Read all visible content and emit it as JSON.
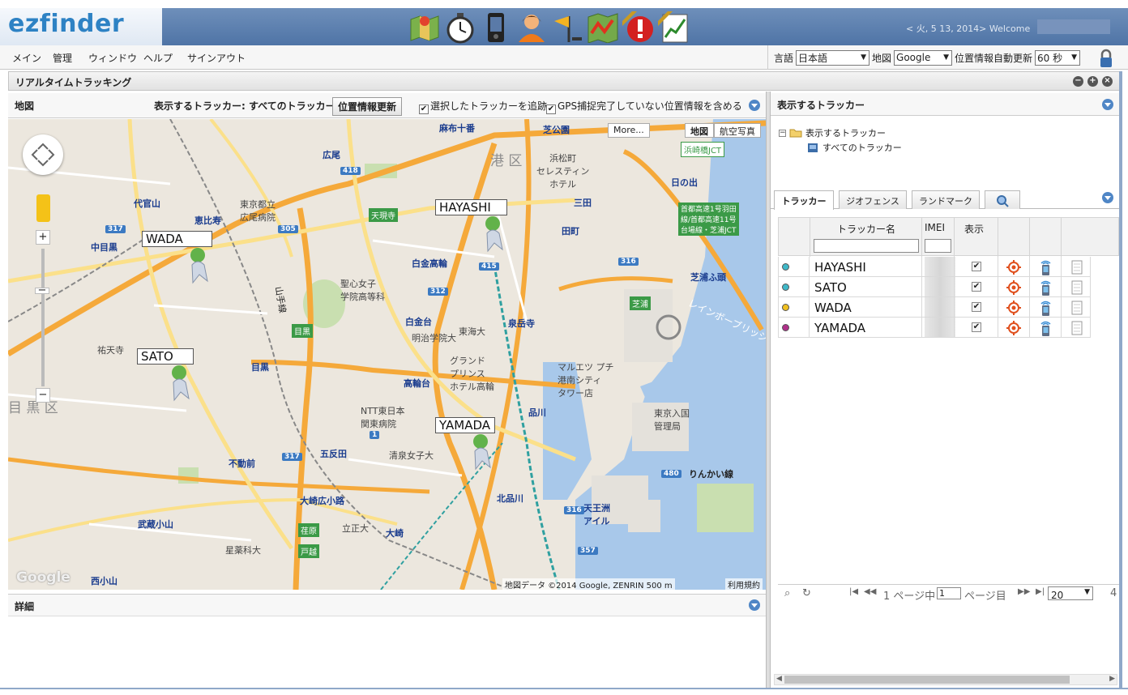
{
  "app": {
    "logo": "ezfinder",
    "welcome": "< 火, 5 13, 2014> Welcome"
  },
  "toolbar_icons": [
    "map-icon",
    "stopwatch-icon",
    "phone-icon",
    "user-icon",
    "flag-icon",
    "route-map-icon",
    "premium-alert-icon",
    "premium-report-icon"
  ],
  "menu": [
    "メイン",
    "管理",
    "ウィンドウ",
    "ヘルプ",
    "サインアウト"
  ],
  "settings": {
    "language_label": "言語",
    "language_value": "日本語",
    "map_label": "地図",
    "map_value": "Google",
    "refresh_label": "位置情報自動更新",
    "refresh_value": "60 秒"
  },
  "panel": {
    "title": "リアルタイムトラッキング"
  },
  "map_header": {
    "title": "地図",
    "trackers_label": "表示するトラッカー: すべてのトラッカー",
    "update_button": "位置情報更新",
    "follow_label": "選択したトラッカーを追跡",
    "gps_label": "GPS捕捉完了していない位置情報を含める"
  },
  "map": {
    "more_button": "More...",
    "type_map": "地図",
    "type_satellite": "航空写真",
    "attribution": "地図データ ©2014 Google, ZENRIN   500 m",
    "terms": "利用規約",
    "google_logo": "Google",
    "labels": {
      "minato": "港 区",
      "meguro": "目 黒 区",
      "azabu": "麻布十番",
      "shiba": "芝公園",
      "hiroo": "広尾",
      "ebisu": "恵比寿",
      "nakameguro": "中目黒",
      "daikanyama": "代官山",
      "shirokane": "白金高輪",
      "shirokanedai": "白金台",
      "mita": "三田",
      "tamachi": "田町",
      "sengakuji": "泉岳寺",
      "shinagawa": "品川",
      "kitashinagawa": "北品川",
      "gotanda": "五反田",
      "osaki": "大崎",
      "osakihirokoji": "大崎広小路",
      "fudomae": "不動前",
      "musashikoyama": "武蔵小山",
      "nishikoyama": "西小山",
      "meguro_st": "目黒",
      "takanawadai": "高輪台",
      "tennozu": "天王洲\nアイル",
      "shibaura": "芝浦ふ頭",
      "hinode": "日の出",
      "rinkai": "りんかい線",
      "yamanote": "山手線",
      "rainbow": "レインボーブリッジ",
      "hospital": "東京都立\n広尾病院",
      "meiji": "明治学院大",
      "tokai": "東海大",
      "seishin": "聖心女子\n学院高等科",
      "yutenji": "祐天寺",
      "ntt": "NTT東日本\n関東病院",
      "shimizu": "清泉女子大",
      "rissho": "立正大",
      "hoshi": "星薬科大",
      "grand_prince": "グランド\nプリンス\nホテル高輪",
      "marche": "マルエツ プチ\n港南シティ\nタワー店",
      "immigration": "東京入国\n管理局",
      "westin": "浜松町\nセレスティン\nホテル"
    },
    "route_labels": {
      "tengenji": "天現寺",
      "shibaura_rt": "芝浦",
      "meguro_rt": "目黒",
      "hamazaki": "浜崎橋JCT",
      "expressway": "首都高速1号羽田\n線/首都高速11号\n台場線・芝浦JCT",
      "ebara": "荏原",
      "togoshi": "戸越"
    },
    "shields": [
      "418",
      "305",
      "317",
      "415",
      "312",
      "316",
      "317",
      "480",
      "357",
      "316",
      "1"
    ]
  },
  "trackers_on_map": [
    {
      "name": "WADA"
    },
    {
      "name": "HAYASHI"
    },
    {
      "name": "SATO"
    },
    {
      "name": "YAMADA"
    }
  ],
  "details": {
    "title": "詳細"
  },
  "right": {
    "title": "表示するトラッカー",
    "tree_root": "表示するトラッカー",
    "tree_child": "すべてのトラッカー",
    "tabs": [
      "トラッカー",
      "ジオフェンス",
      "ランドマーク"
    ],
    "columns": {
      "name": "トラッカー名",
      "imei": "IMEI",
      "display": "表示"
    },
    "rows": [
      {
        "name": "HAYASHI",
        "color": "#3fb8c8",
        "display": "✔"
      },
      {
        "name": "SATO",
        "color": "#3fb8c8",
        "display": "✔"
      },
      {
        "name": "WADA",
        "color": "#f0c020",
        "display": "✔"
      },
      {
        "name": "YAMADA",
        "color": "#b0308a",
        "display": "✔"
      }
    ],
    "pager": {
      "page_prefix": "1 ページ中",
      "page_value": "1",
      "page_suffix": "ページ目",
      "per_page": "20",
      "total": "4"
    }
  }
}
